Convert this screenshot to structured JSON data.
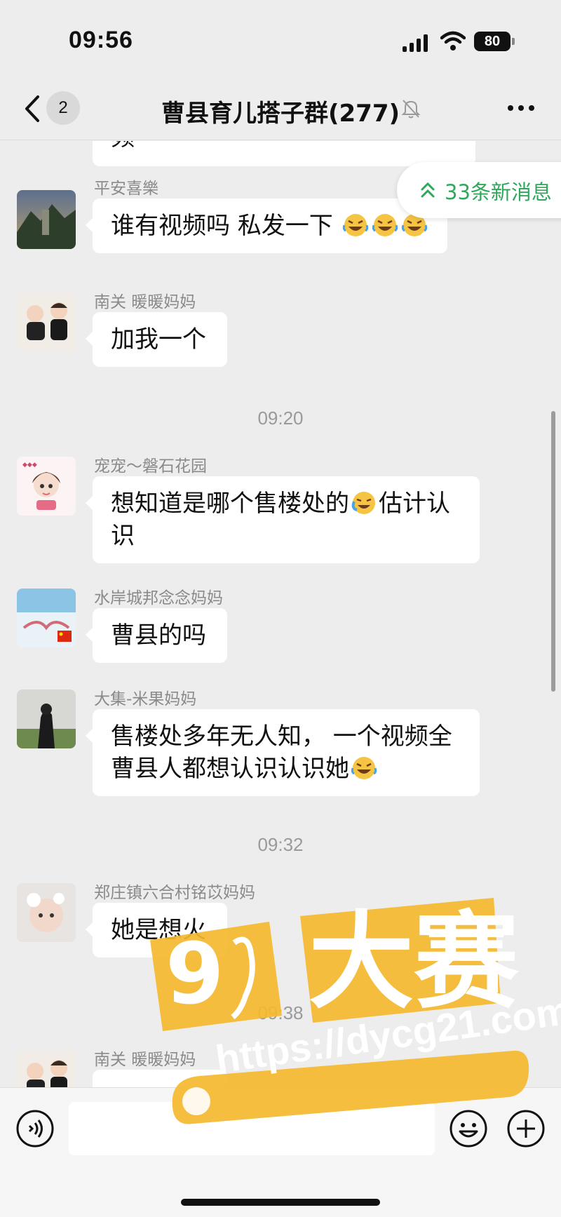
{
  "status_bar": {
    "time": "09:56",
    "battery": "80"
  },
  "nav": {
    "back_count": "2",
    "title": "曹县育儿搭子群(277)"
  },
  "new_messages": {
    "label": "33条新消息"
  },
  "chat": {
    "partial_top_text": "频",
    "messages": [
      {
        "sender": "平安喜樂",
        "text": "谁有视频吗 私发一下",
        "emoji_count": 3
      },
      {
        "sender": "南关 暖暖妈妈",
        "text": "加我一个"
      },
      {
        "sender": "宠宠～磐石花园",
        "text_line1": "想知道是哪个售楼处的",
        "text_line1b": "估计认",
        "text_line2": "识"
      },
      {
        "sender": "水岸城邦念念妈妈",
        "text": "曹县的吗"
      },
      {
        "sender": "大集-米果妈妈",
        "text_line1": "售楼处多年无人知， 一个视频全",
        "text_line2": "曹县人都想认识认识她"
      },
      {
        "sender": "郑庄镇六合村铭苡妈妈",
        "text": "她是想火"
      },
      {
        "sender": "南关 暖暖妈妈",
        "text": ""
      }
    ],
    "time_separators": [
      "09:20",
      "09:32",
      "09:38"
    ]
  },
  "watermark": {
    "brand": "大赛",
    "url": "https://dycg21.com"
  },
  "icons": {
    "back": "chevron-left-icon",
    "mute": "bell-muted-icon",
    "more": "more-dots-icon",
    "voice": "voice-icon",
    "emoji": "smiley-icon",
    "plus": "plus-circle-icon",
    "new_msg": "double-chevron-up-icon"
  },
  "colors": {
    "background": "#ededed",
    "bubble": "#ffffff",
    "accent_green": "#2fa85a",
    "watermark_orange": "#f5b82e"
  }
}
